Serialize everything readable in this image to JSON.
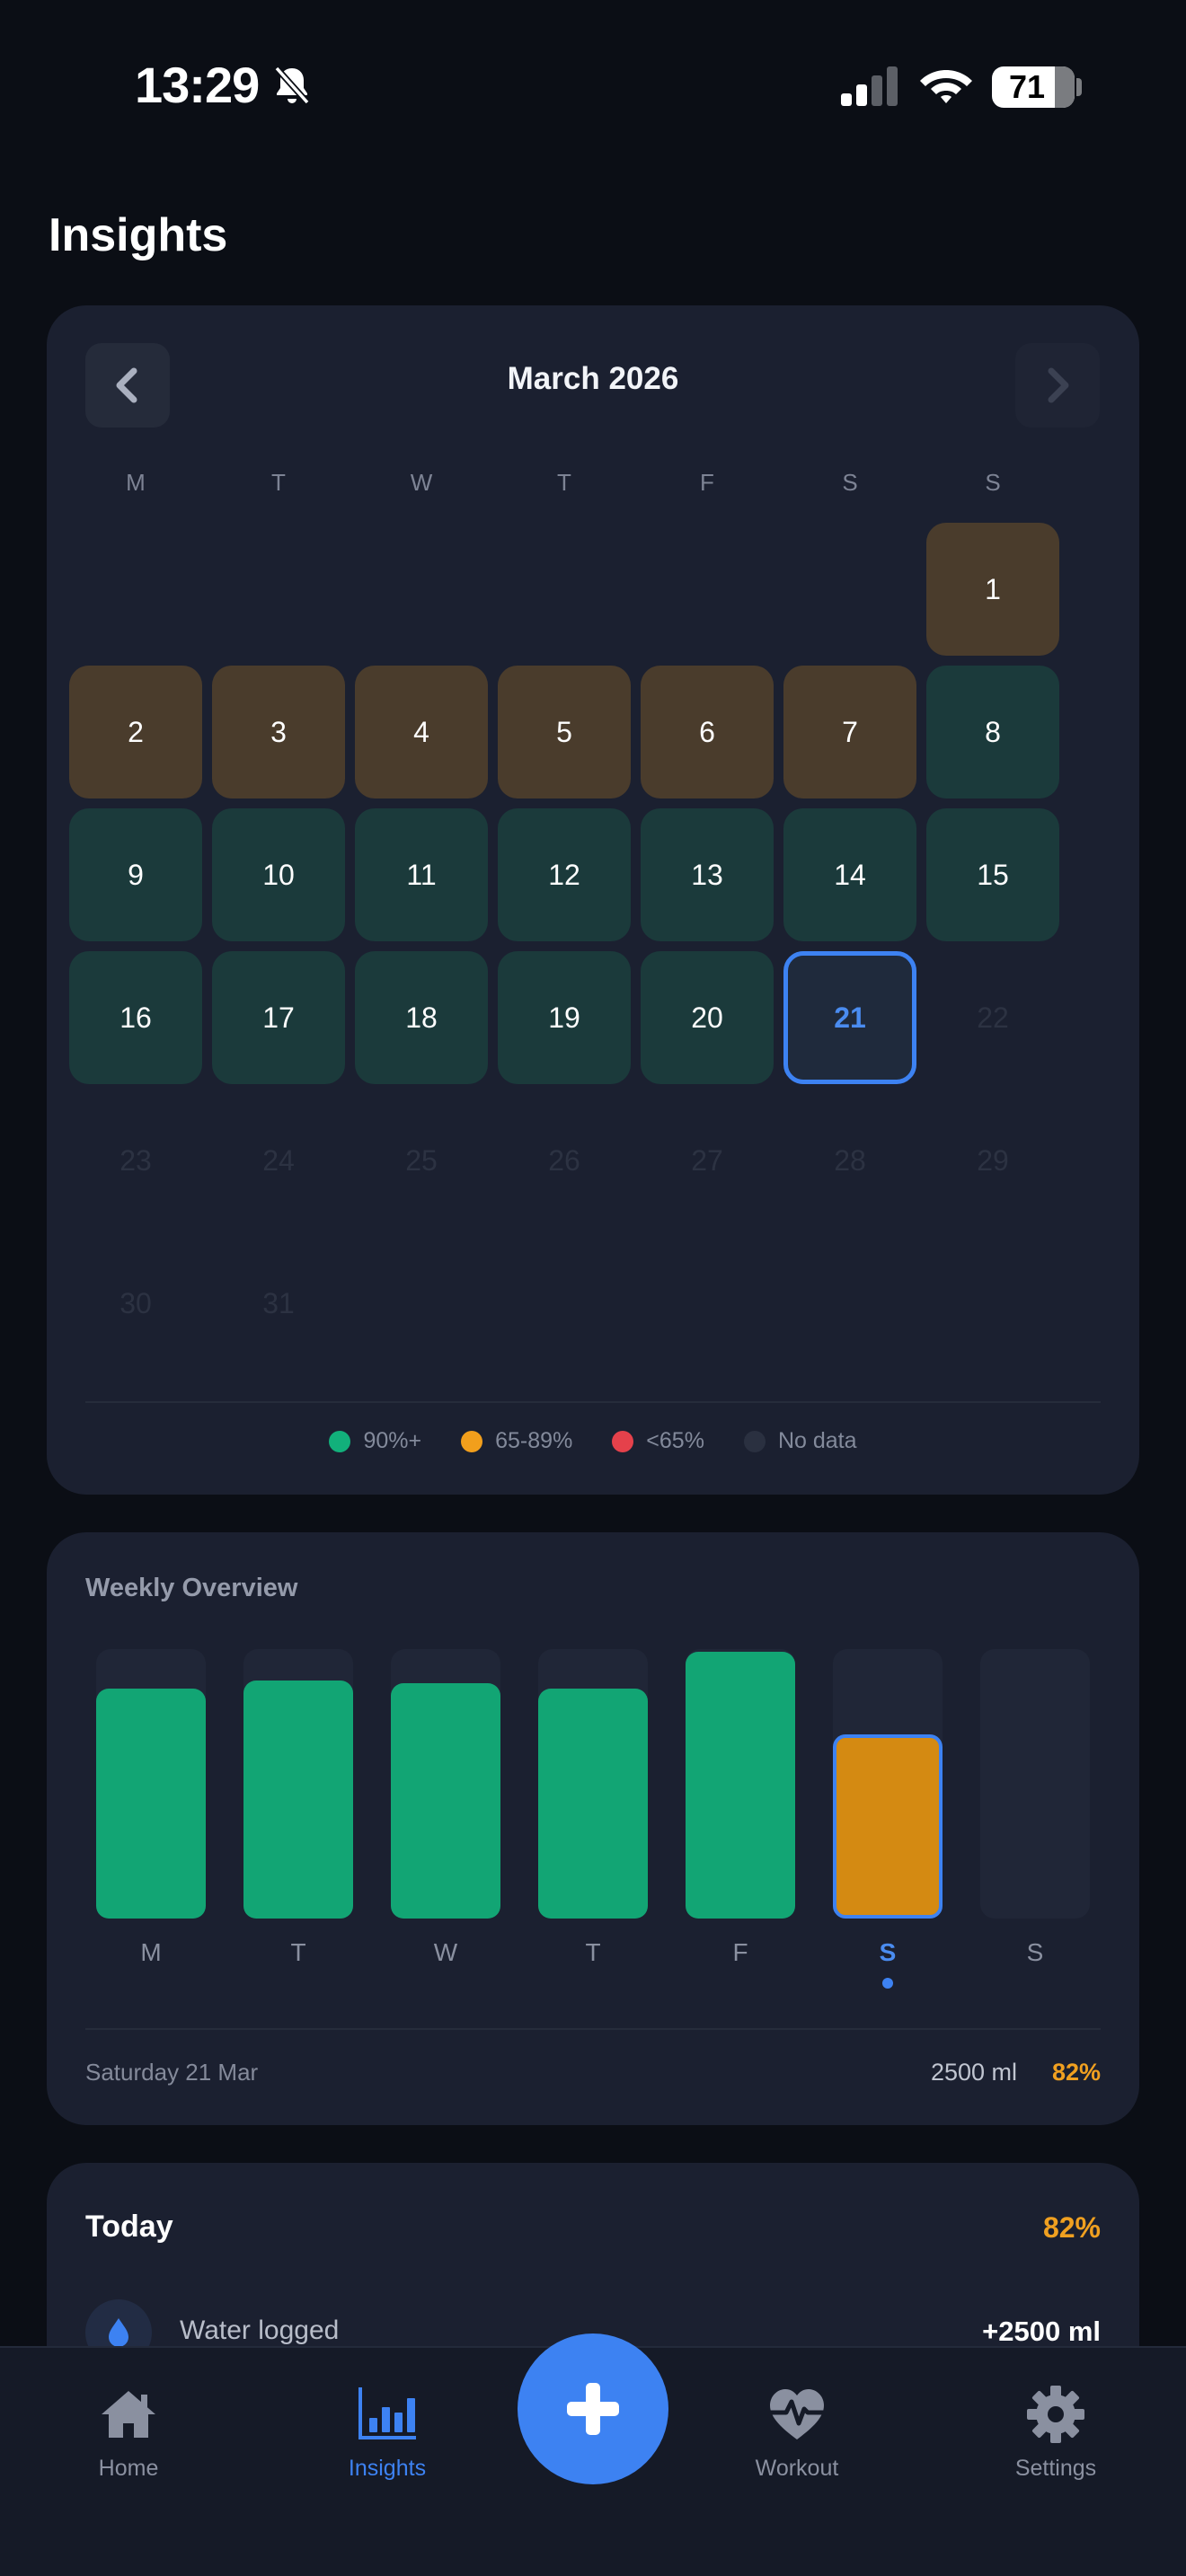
{
  "status_bar": {
    "time": "13:29",
    "battery": "71"
  },
  "page": {
    "title": "Insights"
  },
  "calendar": {
    "month_label": "March 2026",
    "weekdays": [
      "M",
      "T",
      "W",
      "T",
      "F",
      "S",
      "S"
    ],
    "legend": [
      {
        "label": "90%+",
        "color": "#12b07b"
      },
      {
        "label": "65-89%",
        "color": "#f29f1c"
      },
      {
        "label": "<65%",
        "color": "#e5414b"
      },
      {
        "label": "No data",
        "color": "#2a3040"
      }
    ],
    "days": [
      {
        "d": "1",
        "status": "amber"
      },
      {
        "d": "2",
        "status": "amber"
      },
      {
        "d": "3",
        "status": "amber"
      },
      {
        "d": "4",
        "status": "amber"
      },
      {
        "d": "5",
        "status": "amber"
      },
      {
        "d": "6",
        "status": "amber"
      },
      {
        "d": "7",
        "status": "amber"
      },
      {
        "d": "8",
        "status": "green"
      },
      {
        "d": "9",
        "status": "green"
      },
      {
        "d": "10",
        "status": "green"
      },
      {
        "d": "11",
        "status": "green"
      },
      {
        "d": "12",
        "status": "green"
      },
      {
        "d": "13",
        "status": "green"
      },
      {
        "d": "14",
        "status": "green"
      },
      {
        "d": "15",
        "status": "green"
      },
      {
        "d": "16",
        "status": "green"
      },
      {
        "d": "17",
        "status": "green"
      },
      {
        "d": "18",
        "status": "green"
      },
      {
        "d": "19",
        "status": "green"
      },
      {
        "d": "20",
        "status": "green"
      },
      {
        "d": "21",
        "status": "selected"
      },
      {
        "d": "22",
        "status": "empty"
      },
      {
        "d": "23",
        "status": "empty"
      },
      {
        "d": "24",
        "status": "empty"
      },
      {
        "d": "25",
        "status": "empty"
      },
      {
        "d": "26",
        "status": "empty"
      },
      {
        "d": "27",
        "status": "empty"
      },
      {
        "d": "28",
        "status": "empty"
      },
      {
        "d": "29",
        "status": "empty"
      },
      {
        "d": "30",
        "status": "empty"
      },
      {
        "d": "31",
        "status": "empty"
      }
    ]
  },
  "weekly": {
    "title": "Weekly Overview",
    "days": [
      {
        "label": "M",
        "fill": 0.94,
        "color": "#12a574"
      },
      {
        "label": "T",
        "fill": 0.97,
        "color": "#12a574"
      },
      {
        "label": "W",
        "fill": 0.96,
        "color": "#12a574"
      },
      {
        "label": "T",
        "fill": 0.94,
        "color": "#12a574"
      },
      {
        "label": "F",
        "fill": 1.09,
        "color": "#12a574"
      },
      {
        "label": "S",
        "fill": 0.75,
        "color": "#d48a12",
        "active": true
      },
      {
        "label": "S",
        "fill": 0,
        "color": "#202637"
      }
    ],
    "summary_date": "Saturday 21 Mar",
    "summary_ml": "2500 ml",
    "summary_pct": "82%"
  },
  "today": {
    "title": "Today",
    "pct": "82%",
    "entries": [
      {
        "label": "Water logged",
        "amount": "+2500 ml"
      }
    ]
  },
  "tabs": [
    {
      "label": "Home",
      "icon": "home-icon"
    },
    {
      "label": "Insights",
      "icon": "insights-icon",
      "active": true
    },
    {
      "label": "Workout",
      "icon": "workout-icon"
    },
    {
      "label": "Settings",
      "icon": "gear-icon"
    }
  ],
  "colors": {
    "accent": "#3d82f2",
    "warning": "#f0a020",
    "success": "#12a574"
  }
}
